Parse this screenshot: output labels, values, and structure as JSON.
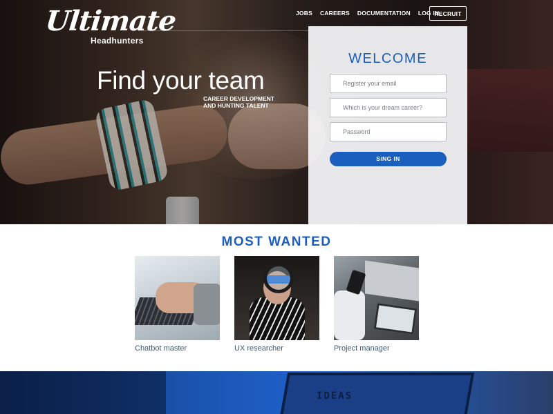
{
  "header": {
    "logo_script": "Ultimate",
    "logo_sub": "Headhunters",
    "nav": [
      "JOBS",
      "CAREERS",
      "DOCUMENTATION",
      "LOG IN"
    ],
    "recruit_label": "RECRUIT"
  },
  "hero": {
    "headline": "Find your team",
    "subline_1": "CAREER DEVELOPMENT",
    "subline_2": "AND HUNTING TALENT"
  },
  "login": {
    "title": "WELCOME",
    "email_placeholder": "Register your email",
    "career_placeholder": "Which is your dream career?",
    "password_placeholder": "Password",
    "submit_label": "SING IN"
  },
  "most_wanted": {
    "title": "MOST WANTED",
    "cards": [
      {
        "caption": "Chatbot master"
      },
      {
        "caption": "UX researcher"
      },
      {
        "caption": "Project manager"
      }
    ]
  },
  "bottom_band": {
    "image_text": "IDEAS"
  },
  "colors": {
    "accent": "#1a5fbd",
    "caption": "#3b5a72",
    "panel": "#f4f4f6"
  }
}
